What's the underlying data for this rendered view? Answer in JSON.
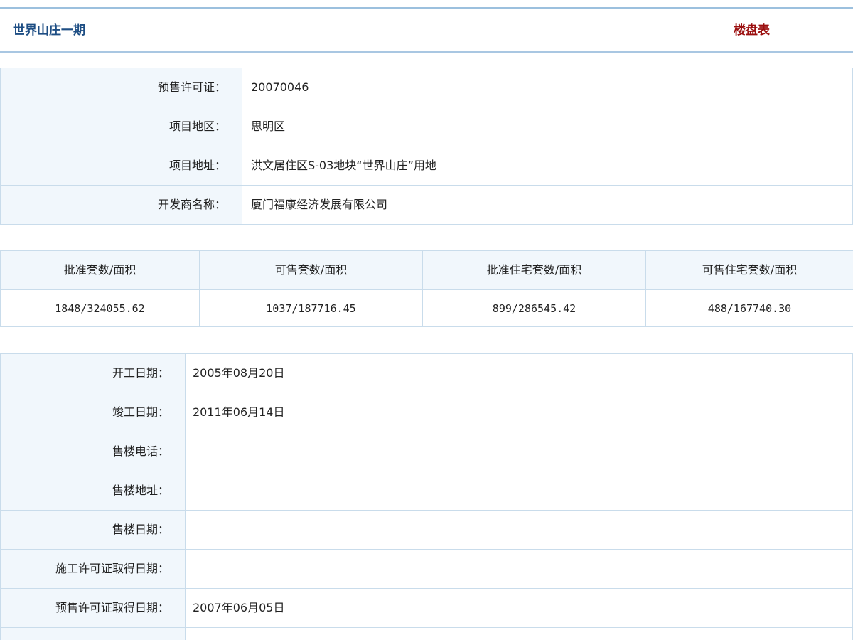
{
  "header": {
    "title": "世界山庄一期",
    "subtitle": "楼盘表"
  },
  "info1": [
    {
      "label": "预售许可证：",
      "value": "20070046"
    },
    {
      "label": "项目地区：",
      "value": "思明区"
    },
    {
      "label": "项目地址：",
      "value": "洪文居住区S-03地块“世界山庄”用地"
    },
    {
      "label": "开发商名称：",
      "value": "厦门福康经济发展有限公司"
    }
  ],
  "stats": {
    "headers": [
      "批准套数/面积",
      "可售套数/面积",
      "批准住宅套数/面积",
      "可售住宅套数/面积"
    ],
    "values": [
      "1848/324055.62",
      "1037/187716.45",
      "899/286545.42",
      "488/167740.30"
    ]
  },
  "info2": [
    {
      "label": "开工日期：",
      "value": "2005年08月20日"
    },
    {
      "label": "竣工日期：",
      "value": "2011年06月14日"
    },
    {
      "label": "售楼电话：",
      "value": ""
    },
    {
      "label": "售楼地址：",
      "value": ""
    },
    {
      "label": "售楼日期：",
      "value": ""
    },
    {
      "label": "施工许可证取得日期：",
      "value": ""
    },
    {
      "label": "预售许可证取得日期：",
      "value": "2007年06月05日"
    },
    {
      "label": "",
      "value": ""
    }
  ],
  "colors": {
    "title": "#1e4e84",
    "subtitle": "#9b0f0f",
    "label_bg": "#f1f7fc",
    "border": "#c9dceb"
  }
}
